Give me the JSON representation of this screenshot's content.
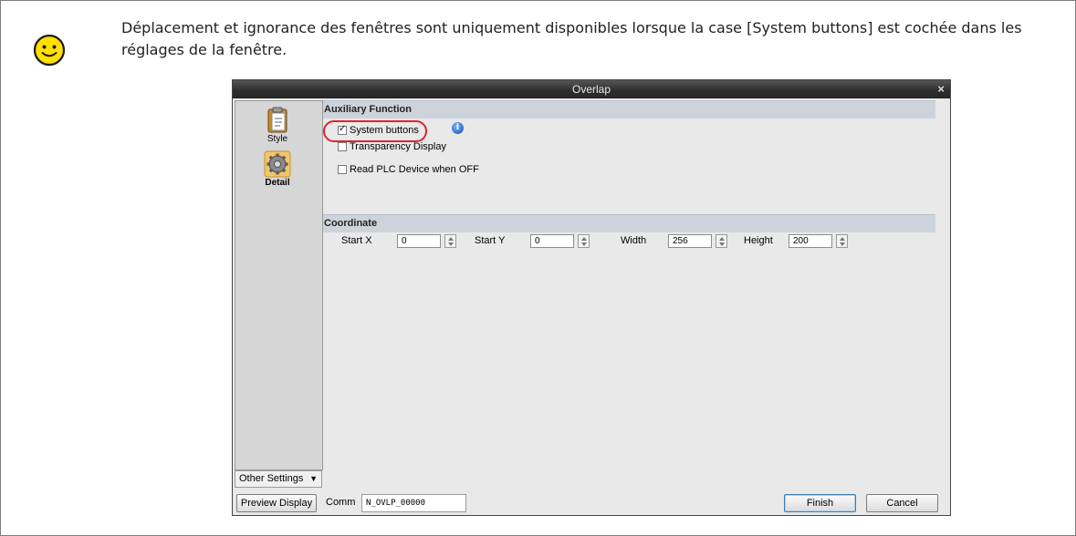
{
  "note": {
    "text": "Déplacement et ignorance des fenêtres sont uniquement disponibles lorsque la case [System buttons] est cochée dans les réglages de la fenêtre.",
    "icon": "smiley-icon",
    "icon_color": "#FFE000"
  },
  "dialog": {
    "title": "Overlap",
    "close_label": "×",
    "sidebar": {
      "items": [
        {
          "label": "Style",
          "icon": "clipboard-icon"
        },
        {
          "label": "Detail",
          "icon": "gear-icon",
          "selected": true
        }
      ],
      "other_settings_label": "Other Settings"
    },
    "auxiliary": {
      "header": "Auxiliary Function",
      "options": [
        {
          "label": "System buttons",
          "checked": true,
          "highlighted": true
        },
        {
          "label": "Transparency Display",
          "checked": false
        },
        {
          "label": "Read PLC Device when OFF",
          "checked": false
        }
      ],
      "info_icon": "info-icon"
    },
    "coordinate": {
      "header": "Coordinate",
      "fields": [
        {
          "label": "Start X",
          "value": "0"
        },
        {
          "label": "Start Y",
          "value": "0"
        },
        {
          "label": "Width",
          "value": "256"
        },
        {
          "label": "Height",
          "value": "200"
        }
      ]
    },
    "footer": {
      "preview_label": "Preview Display",
      "comm_label": "Comm",
      "comm_value": "N_OVLP_00000",
      "finish_label": "Finish",
      "cancel_label": "Cancel"
    },
    "highlight_color": "#E0242A"
  }
}
